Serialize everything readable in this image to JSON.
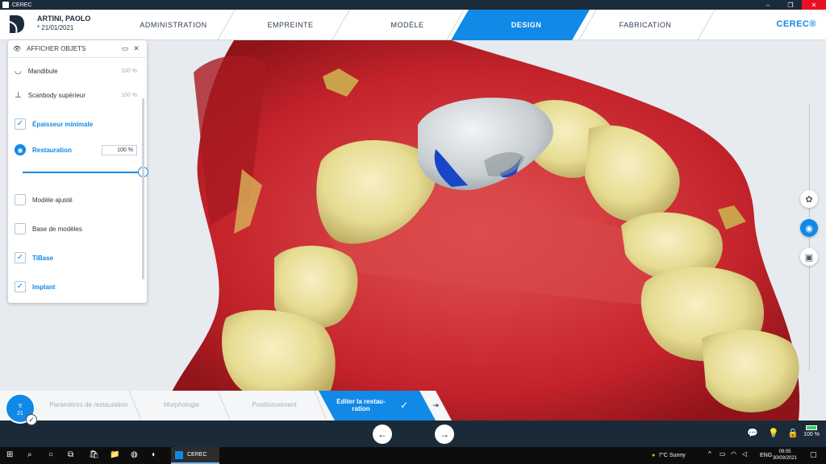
{
  "window": {
    "title": "CEREC"
  },
  "patient": {
    "name": "ARTINI, PAOLO",
    "dob": "* 21/01/2021"
  },
  "nav": {
    "tabs": [
      {
        "label": "ADMINISTRATION"
      },
      {
        "label": "EMPREINTE"
      },
      {
        "label": "MODÈLE"
      },
      {
        "label": "DESIGN"
      },
      {
        "label": "FABRICATION"
      }
    ],
    "active": "DESIGN",
    "brand": "CEREC®"
  },
  "panel": {
    "title": "AFFICHER OBJETS",
    "items": [
      {
        "label": "Mandibule",
        "value": "100 %",
        "checked": null
      },
      {
        "label": "Scanbody supérieur",
        "value": "100 %",
        "checked": null
      },
      {
        "label": "Épaisseur minimale",
        "checked": true
      },
      {
        "label": "Restauration",
        "value": "100 %",
        "checked": null
      },
      {
        "label": "Modèle ajusté",
        "checked": false
      },
      {
        "label": "Base de modèles",
        "checked": false
      },
      {
        "label": "TiBase",
        "checked": true
      },
      {
        "label": "Implant",
        "checked": true
      }
    ],
    "restoration_opacity": 1.0
  },
  "steps": {
    "tooth_number": "21",
    "items": [
      {
        "label": "Paramètres de restauration"
      },
      {
        "label": "Morphologie"
      },
      {
        "label": "Positionnement"
      },
      {
        "label": "Editer la restau- ration"
      }
    ],
    "active_index": 3
  },
  "status": {
    "battery": "100 %"
  },
  "taskbar": {
    "app_label": "CEREC",
    "weather": "7°C Sunny",
    "lang": "ENG",
    "time": "09:05",
    "date": "30/09/2021"
  },
  "colors": {
    "accent": "#1189e6",
    "dark_bar": "#1a2a38",
    "gum": "#c4232b",
    "tooth": "#e6dc92"
  }
}
